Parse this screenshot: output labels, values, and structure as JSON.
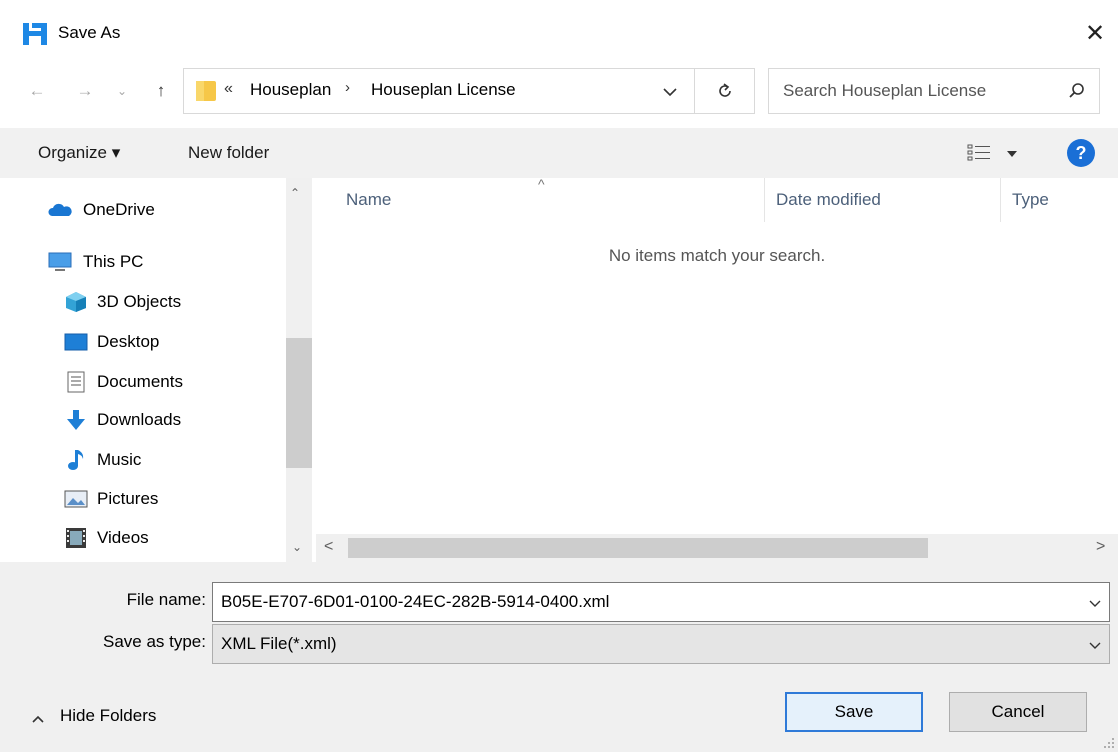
{
  "window": {
    "title": "Save As",
    "close_glyph": "✕"
  },
  "nav": {
    "back_glyph": "←",
    "forward_glyph": "→",
    "recent_glyph": "⌄",
    "up_glyph": "↑",
    "chevron": "«",
    "breadcrumbs": [
      "Houseplan",
      "Houseplan License"
    ],
    "separator": "›",
    "search_placeholder": "Search Houseplan License"
  },
  "toolbar": {
    "organize_label": "Organize ▾",
    "new_folder_label": "New folder",
    "help_glyph": "?"
  },
  "sidebar": {
    "items": [
      {
        "label": "OneDrive",
        "icon": "onedrive-icon"
      },
      {
        "label": "This PC",
        "icon": "this-pc-icon"
      },
      {
        "label": "3D Objects",
        "icon": "3d-objects-icon"
      },
      {
        "label": "Desktop",
        "icon": "desktop-icon"
      },
      {
        "label": "Documents",
        "icon": "documents-icon"
      },
      {
        "label": "Downloads",
        "icon": "downloads-icon"
      },
      {
        "label": "Music",
        "icon": "music-icon"
      },
      {
        "label": "Pictures",
        "icon": "pictures-icon"
      },
      {
        "label": "Videos",
        "icon": "videos-icon"
      }
    ],
    "scroll_up": "⌃",
    "scroll_down": "⌄"
  },
  "list": {
    "columns": [
      "Name",
      "Date modified",
      "Type"
    ],
    "sort_caret": "^",
    "empty_message": "No items match your search.",
    "scroll_left": "<",
    "scroll_right": ">"
  },
  "form": {
    "file_name_label": "File name:",
    "file_name_value": "B05E-E707-6D01-0100-24EC-282B-5914-0400.xml",
    "save_type_label": "Save as type:",
    "save_type_value": "XML File(*.xml)"
  },
  "footer": {
    "hide_folders_label": "Hide Folders",
    "save_label": "Save",
    "cancel_label": "Cancel"
  },
  "colors": {
    "accent": "#2f7ad8",
    "help_blue": "#1a6fd6",
    "folder_yellow": "#f6c748",
    "toolbar_bg": "#f1f1f1"
  }
}
